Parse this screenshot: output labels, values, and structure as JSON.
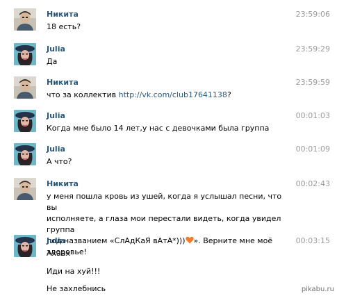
{
  "colors": {
    "author": "#2b587a",
    "time": "#999999",
    "link": "#2b587a",
    "heart": "#f47b2a"
  },
  "messages": [
    {
      "author": "Никита",
      "time": "23:59:06",
      "avatar": "nikita-avatar",
      "lines": [
        "18 есть?"
      ]
    },
    {
      "author": "Julia",
      "time": "23:59:29",
      "avatar": "julia-avatar",
      "lines": [
        "Да"
      ]
    },
    {
      "author": "Никита",
      "time": "23:59:59",
      "avatar": "nikita-avatar",
      "text_prefix": "что за коллектив ",
      "link": "http://vk.com/club17641138",
      "text_suffix": "?"
    },
    {
      "author": "Julia",
      "time": "00:01:03",
      "avatar": "julia-avatar",
      "lines": [
        "Когда мне было 14 лет,у нас с девочками была группа"
      ]
    },
    {
      "author": "Julia",
      "time": "00:01:09",
      "avatar": "julia-avatar",
      "lines": [
        "А что?"
      ]
    },
    {
      "author": "Никита",
      "time": "00:02:43",
      "avatar": "nikita-avatar",
      "lines": [
        "у меня пошла кровь из ушей, когда я услышал песни, что вы",
        "исполняете, а глаза мои перестали видеть, когда увидел группа"
      ],
      "last_prefix": "под названием «СлАдКаЯ вАтА*)))",
      "heart_icon": "heart-icon",
      "last_suffix": "». Верните мне моё здоровье!"
    },
    {
      "author": "Julia",
      "time": "00:03:15",
      "avatar": "julia-avatar",
      "lines": [
        "Ахаах",
        "Иди на хуй!!!",
        "Не захлебнись"
      ]
    }
  ],
  "watermark": "pikabu.ru"
}
